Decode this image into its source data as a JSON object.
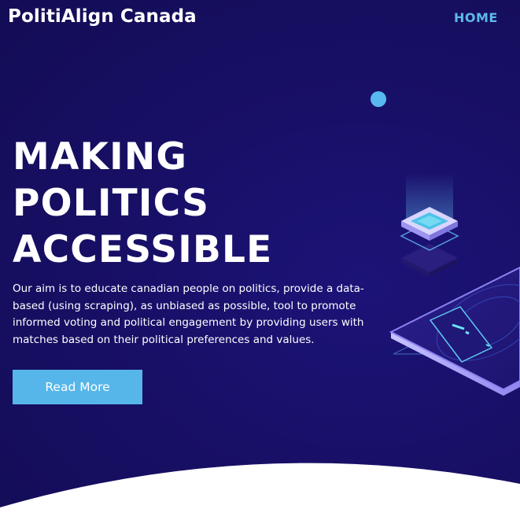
{
  "header": {
    "brand": "PolitiAlign Canada",
    "nav": {
      "home_label": "HOME"
    }
  },
  "hero": {
    "title_lines": [
      "MAKING",
      "POLITICS",
      "ACCESSIBLE"
    ],
    "description": "Our aim is to educate canadian people on politics, provide a data-based (using scraping), as unbiased as possible, tool to promote informed voting and political engagement by providing users with matches based on their political preferences and values.",
    "cta_label": "Read More"
  },
  "illustration": {
    "icon": "isometric-phone-icon"
  },
  "colors": {
    "background": "#170f63",
    "accent": "#56b6ea",
    "nav_link": "#5cb8ea",
    "text": "#ffffff"
  }
}
